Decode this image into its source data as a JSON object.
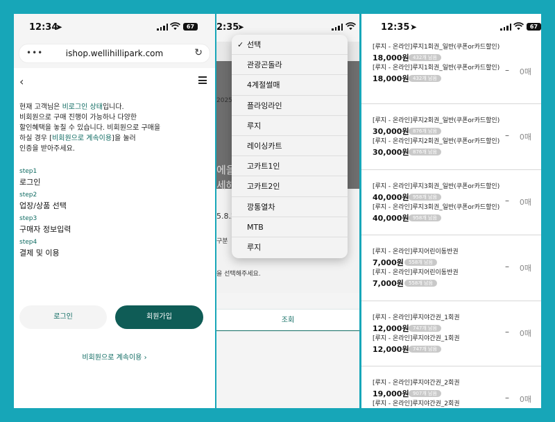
{
  "panel1": {
    "status": {
      "time": "12:34",
      "battery": "67"
    },
    "browser": {
      "url": "ishop.wellihillipark.com"
    },
    "notice": {
      "p1": "현재 고객님은 ",
      "status_word": "비로그인 상태",
      "p2": "입니다.",
      "line2": "비회원으로 구매 진행이 가능하나 다양한",
      "line3": "할인혜택을 놓칠 수 있습니다. 비회원으로 구매을",
      "line4_a": "하실 경우 [",
      "line4_link": "비회원으로 계속이용",
      "line4_b": "]을 눌러",
      "line5": "인증을 받아주세요."
    },
    "steps": [
      {
        "num": "step1",
        "label": "로그인"
      },
      {
        "num": "step2",
        "label": "업장/상품 선택"
      },
      {
        "num": "step3",
        "label": "구매자 정보입력"
      },
      {
        "num": "step4",
        "label": "결제 및 이용"
      }
    ],
    "login_button": "로그인",
    "signup_button": "회원가입",
    "guest_link": "비회원으로 계속이용 ›"
  },
  "panel2": {
    "status": {
      "time": "2:35"
    },
    "bg": {
      "date1": "2025.",
      "text1": "에을",
      "text2": "세해",
      "date2": "5.8.2",
      "label": "구분",
      "hint": "을 선택해주세요.",
      "search_button": "조회"
    },
    "dropdown": {
      "selected": "선택",
      "items": [
        "선택",
        "관광곤돌라",
        "4계절썰매",
        "플라잉라인",
        "루지",
        "레이싱카트",
        "고카트1인",
        "고카트2인",
        "깡통열차",
        "MTB",
        "루지"
      ]
    }
  },
  "panel3": {
    "status": {
      "time": "12:35",
      "battery": "67"
    },
    "groups": [
      {
        "name": "[루지 - 온라인]루지1회권_일반(쿠폰or카드할인)",
        "price": "18,000원",
        "remain": "432개 남음",
        "qty": "0매"
      },
      {
        "name": "[루지 - 온라인]루지2회권_일반(쿠폰or카드할인)",
        "price": "30,000원",
        "remain": "876개 남음",
        "qty": "0매"
      },
      {
        "name": "[루지 - 온라인]루지3회권_일반(쿠폰or카드할인)",
        "price": "40,000원",
        "remain": "958개 남음",
        "qty": "0매"
      },
      {
        "name": "[루지 - 온라인]루지어린이동반권",
        "price": "7,000원",
        "remain": "558개 남음",
        "qty": "0매"
      },
      {
        "name": "[루지 - 온라인]루지야간권_1회권",
        "price": "12,000원",
        "remain": "747개 남음",
        "qty": "0매"
      },
      {
        "name": "[루지 - 온라인]루지야간권_2회권",
        "price": "19,000원",
        "remain": "907개 남음",
        "qty": "0매"
      }
    ],
    "minus_symbol": "–"
  }
}
